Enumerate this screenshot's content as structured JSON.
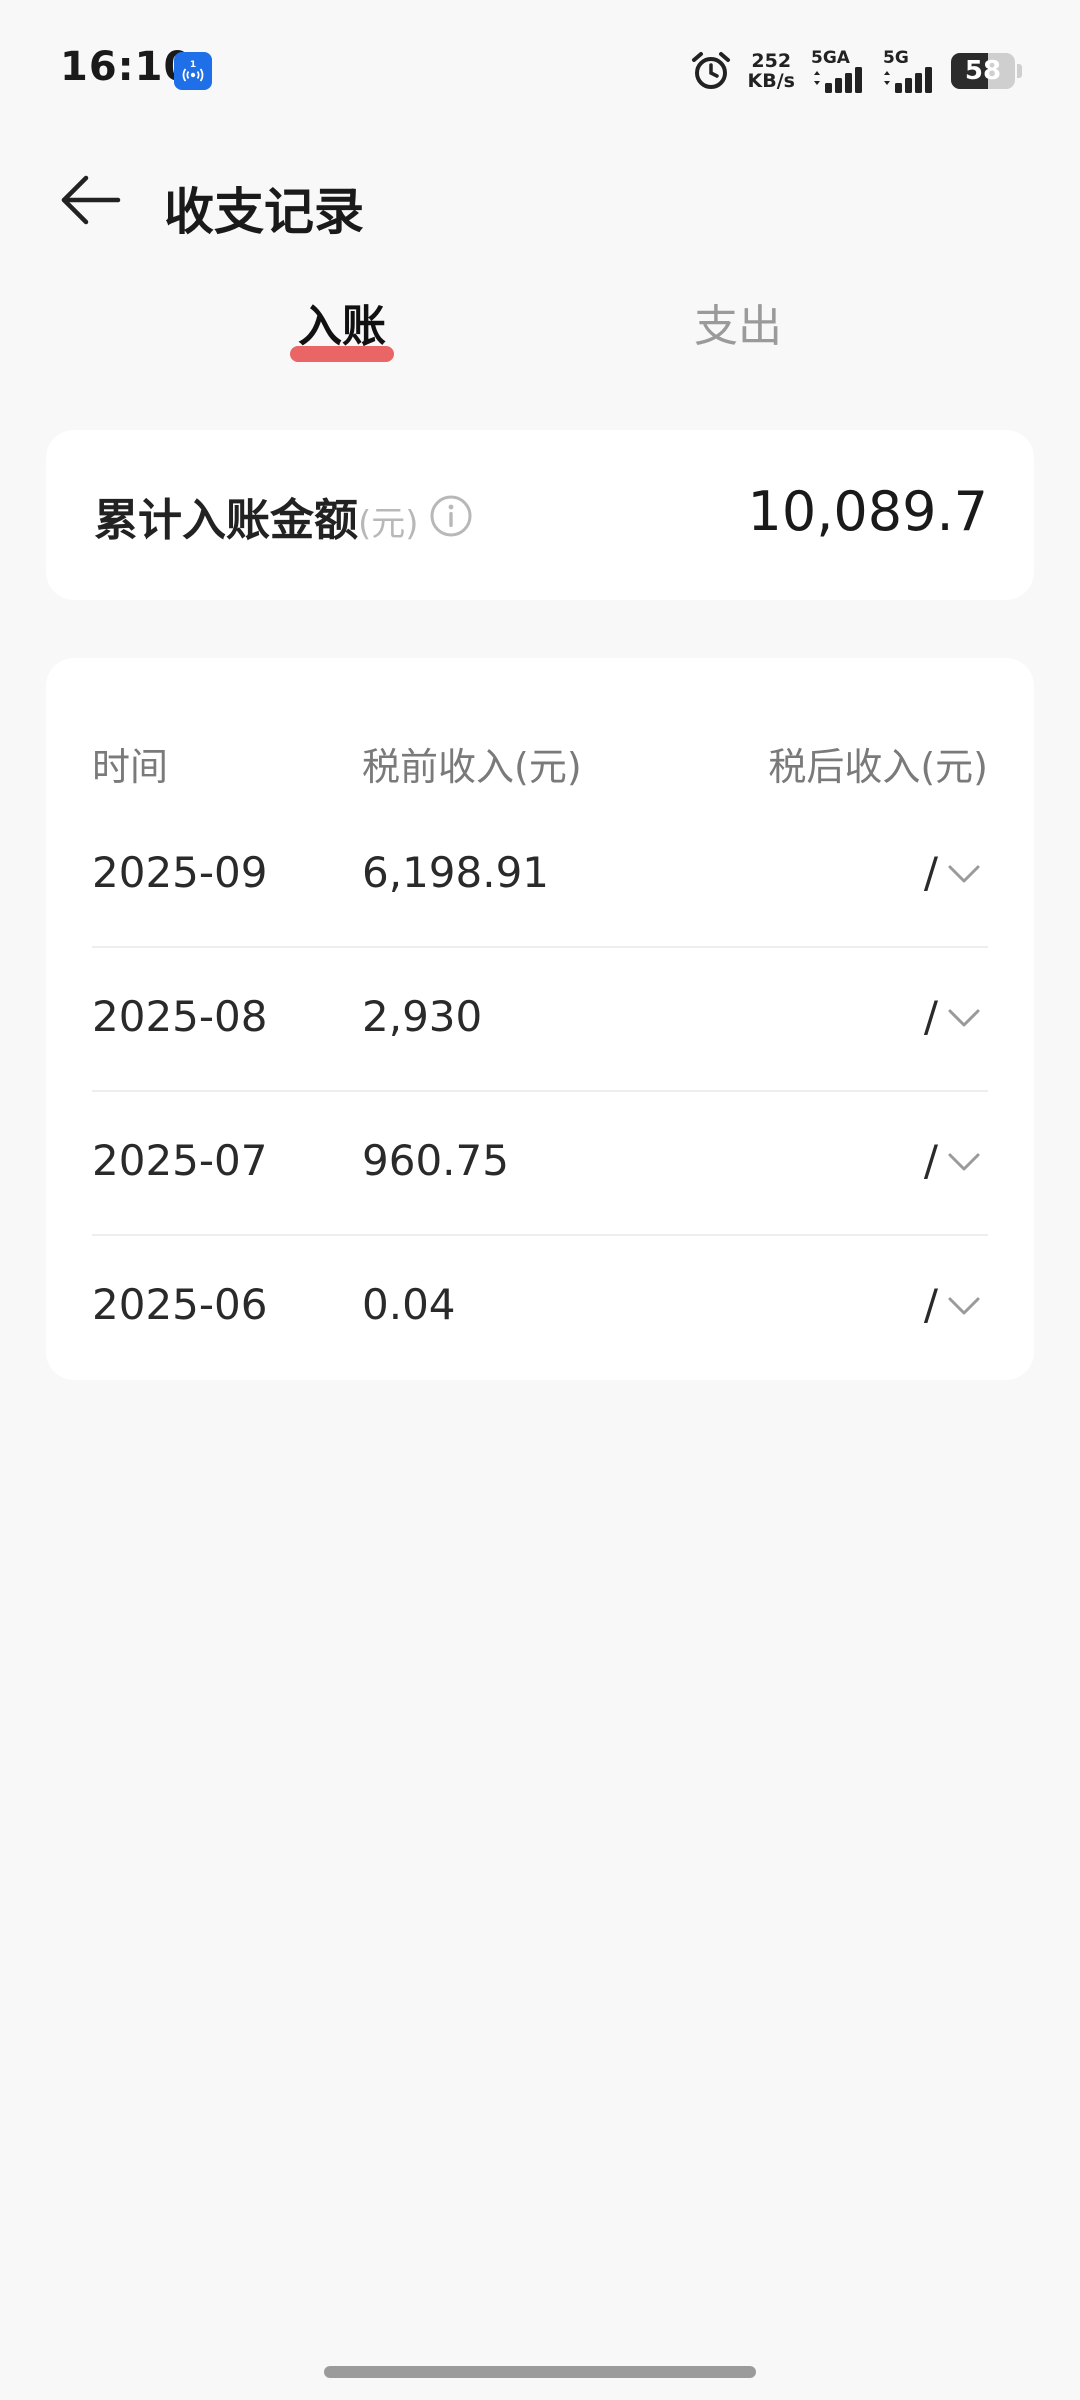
{
  "status_bar": {
    "time": "16:10",
    "hotspot_icon": "hotspot-icon",
    "alarm_icon": "alarm-clock-icon",
    "net_speed_value": "252",
    "net_speed_unit": "KB/s",
    "sim1_label": "5GA",
    "sim2_label": "5G",
    "battery_level": "58"
  },
  "header": {
    "back_icon": "arrow-left-icon",
    "title": "收支记录"
  },
  "tabs": [
    {
      "label": "入账",
      "active": true
    },
    {
      "label": "支出",
      "active": false
    }
  ],
  "summary": {
    "label": "累计入账金额",
    "unit": "(元)",
    "info_icon": "info-icon",
    "amount": "10,089.7"
  },
  "table": {
    "headers": {
      "time": "时间",
      "pre_tax": "税前收入(元)",
      "post_tax": "税后收入(元)"
    },
    "rows": [
      {
        "date": "2025-09",
        "pre_tax": "6,198.91",
        "post_tax": "/"
      },
      {
        "date": "2025-08",
        "pre_tax": "2,930",
        "post_tax": "/"
      },
      {
        "date": "2025-07",
        "pre_tax": "960.75",
        "post_tax": "/"
      },
      {
        "date": "2025-06",
        "pre_tax": "0.04",
        "post_tax": "/"
      }
    ]
  },
  "colors": {
    "accent": "#e85454",
    "background": "#f8f8f8",
    "card": "#ffffff"
  }
}
